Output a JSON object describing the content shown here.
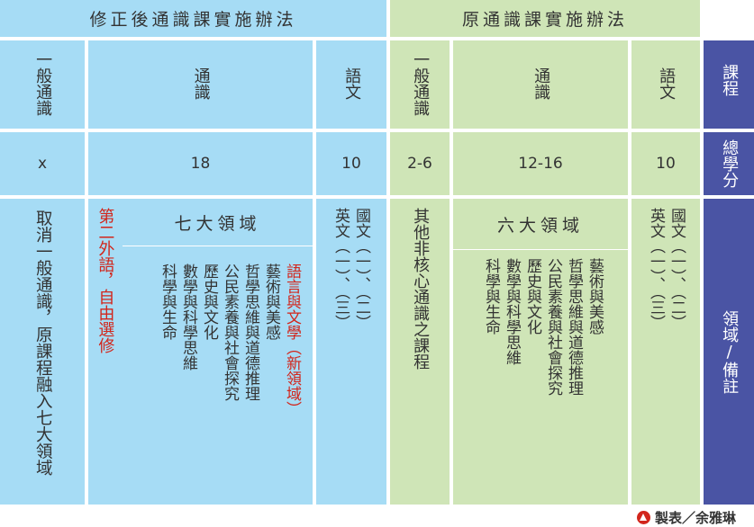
{
  "headers": {
    "revised": "修正後通識課實施辦法",
    "original": "原通識課實施辦法"
  },
  "side_labels": {
    "course": "課程",
    "credits": "總學分",
    "domain": "領域/備註"
  },
  "columns": {
    "revised_general": "一般通識",
    "revised_tongshi": "通識",
    "revised_language": "語文",
    "original_general": "一般通識",
    "original_tongshi": "通識",
    "original_language": "語文"
  },
  "credits": {
    "revised_general": "x",
    "revised_tongshi": "18",
    "revised_language": "10",
    "original_general": "2-6",
    "original_tongshi": "12-16",
    "original_language": "10"
  },
  "notes": {
    "revised_general": "取消一般通識，原課程融入七大領域",
    "second_language": "第二外語，自由選修",
    "seven_domains_title": "七大領域",
    "seven_domains": [
      "語言與文學（新領域）",
      "藝術與美感",
      "哲學思維與道德推理",
      "公民素養與社會探究",
      "歷史與文化",
      "數學與科學思維",
      "科學與生命"
    ],
    "revised_language_list": [
      "國文（一）、（二）",
      "英文（一）、（三）"
    ],
    "original_general": "其他非核心通識之課程",
    "six_domains_title": "六大領域",
    "six_domains": [
      "藝術與美感",
      "哲學思維與道德推理",
      "公民素養與社會探究",
      "歷史與文化",
      "數學與科學思維",
      "科學與生命"
    ],
    "original_language_list": [
      "國文（一）、（二）",
      "英文（一）、（三）"
    ]
  },
  "footer": {
    "credit": "製表／余雅琳"
  },
  "colors": {
    "revised_bg": "#a6dcf5",
    "original_bg": "#cfe5b7",
    "side_bg": "#4a54a4",
    "highlight": "#d2261c"
  }
}
